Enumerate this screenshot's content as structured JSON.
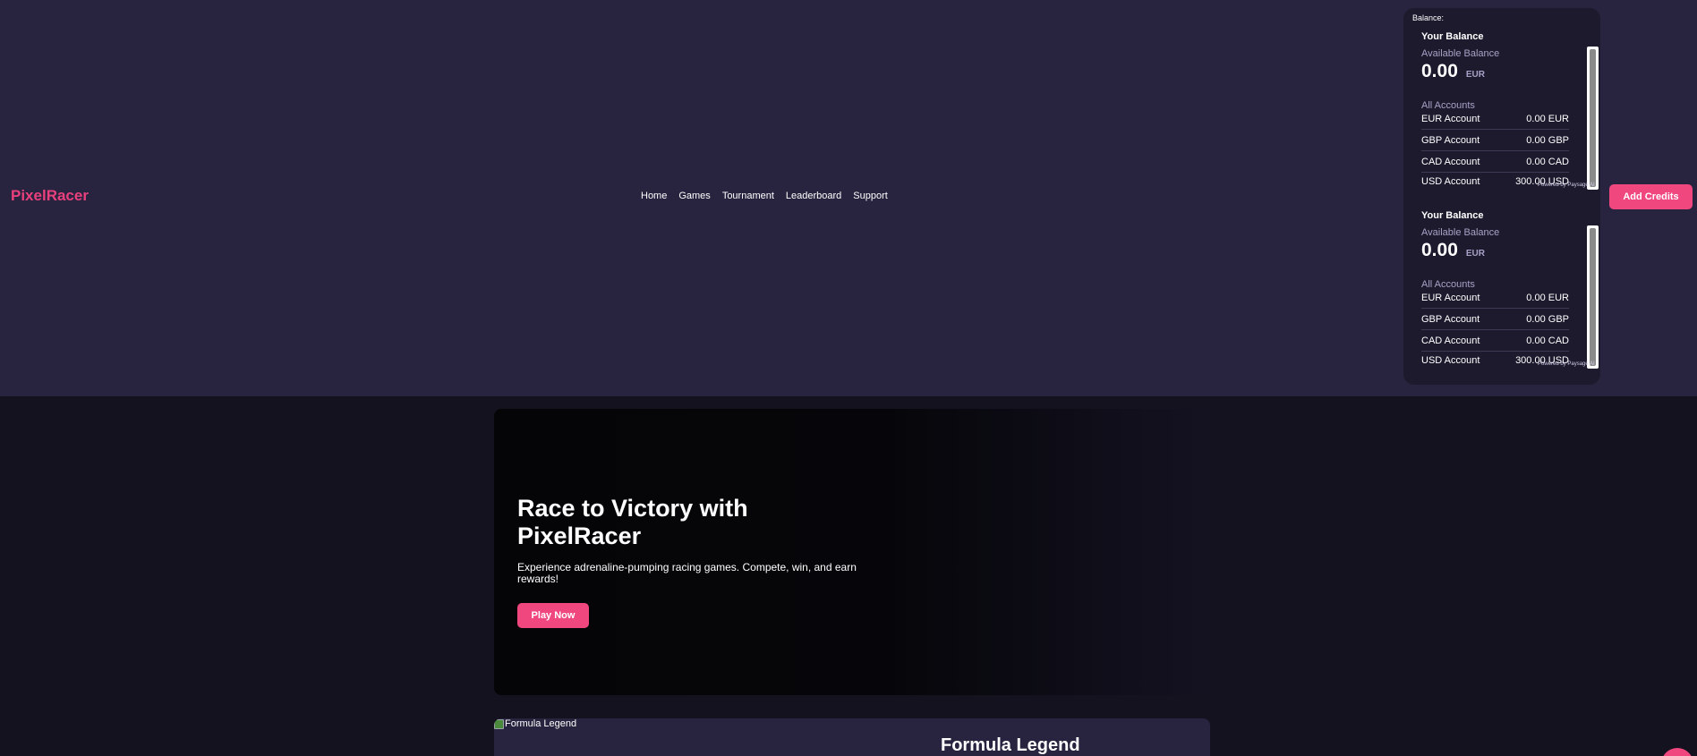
{
  "brand": {
    "name": "PixelRacer"
  },
  "nav": [
    "Home",
    "Games",
    "Tournament",
    "Leaderboard",
    "Support"
  ],
  "balance": {
    "label": "Balance:",
    "cards": [
      {
        "title": "Your Balance",
        "available_label": "Available Balance",
        "amount": "0.00",
        "currency": "EUR",
        "all_accounts_label": "All Accounts",
        "accounts": [
          {
            "name": "EUR Account",
            "value": "0.00 EUR"
          },
          {
            "name": "GBP Account",
            "value": "0.00 GBP"
          },
          {
            "name": "CAD Account",
            "value": "0.00 CAD"
          },
          {
            "name": "USD Account",
            "value": "300.00 USD"
          }
        ],
        "powered_by": "Powered by Paysage AI"
      },
      {
        "title": "Your Balance",
        "available_label": "Available Balance",
        "amount": "0.00",
        "currency": "EUR",
        "all_accounts_label": "All Accounts",
        "accounts": [
          {
            "name": "EUR Account",
            "value": "0.00 EUR"
          },
          {
            "name": "GBP Account",
            "value": "0.00 GBP"
          },
          {
            "name": "CAD Account",
            "value": "0.00 CAD"
          },
          {
            "name": "USD Account",
            "value": "300.00 USD"
          }
        ],
        "powered_by": "Powered by Paysage AI"
      }
    ]
  },
  "header": {
    "add_credits_label": "Add Credits"
  },
  "hero": {
    "title": "Race to Victory with PixelRacer",
    "subtitle": "Experience adrenaline-pumping racing games. Compete, win, and earn rewards!",
    "cta_label": "Play Now"
  },
  "game": {
    "image_alt": "Formula Legend",
    "title": "Formula Legend"
  },
  "colors": {
    "accent": "#f0477f",
    "header_bg": "#28243f",
    "page_bg": "#15121f"
  }
}
